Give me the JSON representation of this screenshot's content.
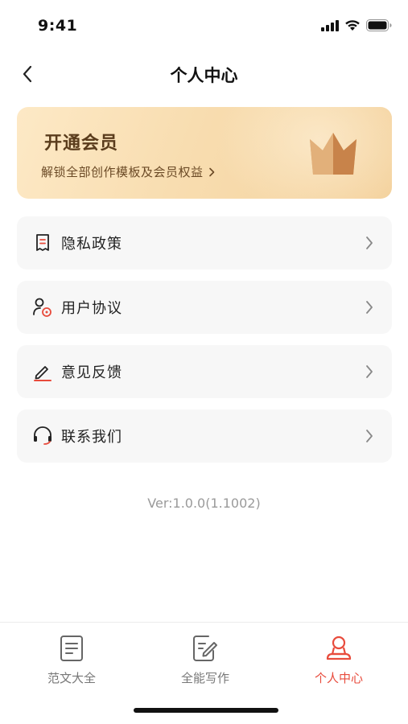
{
  "status": {
    "time": "9:41"
  },
  "nav": {
    "title": "个人中心"
  },
  "vip": {
    "title": "开通会员",
    "subtitle": "解锁全部创作模板及会员权益"
  },
  "menu": [
    {
      "label": "隐私政策",
      "icon": "document-icon"
    },
    {
      "label": "用户协议",
      "icon": "user-agreement-icon"
    },
    {
      "label": "意见反馈",
      "icon": "edit-icon"
    },
    {
      "label": "联系我们",
      "icon": "headset-icon"
    }
  ],
  "version": "Ver:1.0.0(1.1002)",
  "tabs": [
    {
      "label": "范文大全",
      "icon": "document-list-icon",
      "active": false
    },
    {
      "label": "全能写作",
      "icon": "write-icon",
      "active": false
    },
    {
      "label": "个人中心",
      "icon": "profile-icon",
      "active": true
    }
  ],
  "colors": {
    "accent": "#e84b3c",
    "vip_text": "#5a3c1c",
    "card_bg": "#f7f7f7"
  }
}
